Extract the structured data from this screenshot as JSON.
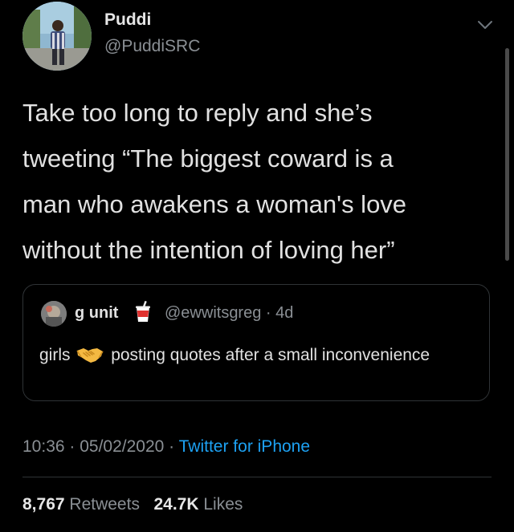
{
  "author": {
    "name": "Puddi",
    "handle": "@PuddiSRC"
  },
  "tweet": {
    "lines": [
      "Take too long to reply and she’s",
      "tweeting “The biggest coward is a",
      "man who awakens a woman's love",
      "without the intention of loving her”"
    ]
  },
  "quoted_tweet": {
    "name": "g unit",
    "name_emoji": "cup-with-straw-icon",
    "handle_line": "@ewwitsgreg · 4d",
    "text_before": "girls",
    "text_emoji": "handshake-icon",
    "text_after": "posting quotes after a small inconvenience"
  },
  "meta": {
    "time": "10:36 · 05/02/2020 ·",
    "source": "Twitter for iPhone"
  },
  "stats": {
    "retweets_count": "8,767",
    "retweets_label": "Retweets",
    "likes_count": "24.7K",
    "likes_label": "Likes"
  },
  "colors": {
    "background": "#000000",
    "text": "#e1e1e1",
    "secondary": "#8a8f94",
    "link": "#1da1f2",
    "border": "#2f3336"
  },
  "icons": [
    "chevron-down-icon",
    "cup-with-straw-icon",
    "handshake-icon"
  ]
}
